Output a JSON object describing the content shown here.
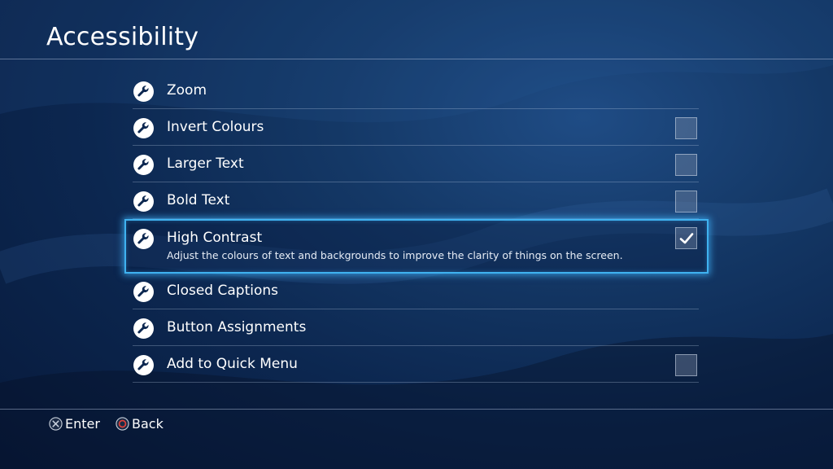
{
  "page": {
    "title": "Accessibility"
  },
  "menu": {
    "items": [
      {
        "label": "Zoom",
        "icon": "wrench-icon",
        "has_checkbox": false
      },
      {
        "label": "Invert Colours",
        "icon": "wrench-icon",
        "has_checkbox": true,
        "checked": false
      },
      {
        "label": "Larger Text",
        "icon": "wrench-icon",
        "has_checkbox": true,
        "checked": false
      },
      {
        "label": "Bold Text",
        "icon": "wrench-icon",
        "has_checkbox": true,
        "checked": false
      },
      {
        "label": "High Contrast",
        "icon": "wrench-icon",
        "has_checkbox": true,
        "checked": true,
        "selected": true,
        "description": "Adjust the colours of text and backgrounds to improve the clarity of things on the screen."
      },
      {
        "label": "Closed Captions",
        "icon": "wrench-icon",
        "has_checkbox": false
      },
      {
        "label": "Button Assignments",
        "icon": "wrench-icon",
        "has_checkbox": false
      },
      {
        "label": "Add to Quick Menu",
        "icon": "wrench-icon",
        "has_checkbox": true,
        "checked": false
      }
    ]
  },
  "footer": {
    "enter_label": "Enter",
    "enter_icon": "cross-button-icon",
    "back_label": "Back",
    "back_icon": "circle-button-icon"
  },
  "colors": {
    "background": "#0c2750",
    "highlight": "#3fb2f0",
    "text": "#ffffff",
    "circle_button": "#e0403a"
  }
}
